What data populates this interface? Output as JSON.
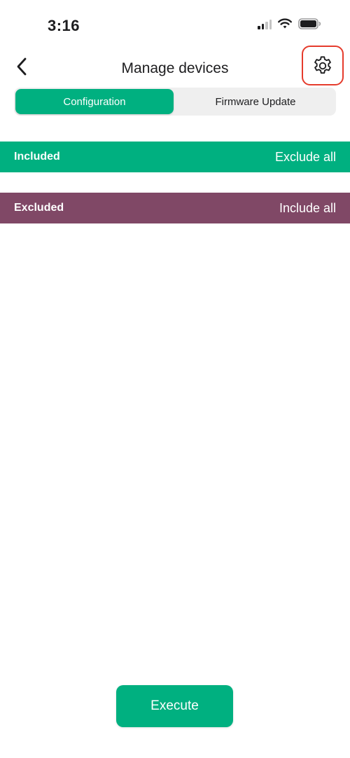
{
  "status_bar": {
    "time": "3:16",
    "icons": [
      "cellular-signal-icon",
      "wifi-icon",
      "battery-icon"
    ]
  },
  "nav": {
    "title": "Manage devices",
    "back_icon": "chevron-left-icon",
    "settings_icon": "gear-icon"
  },
  "tabs": [
    {
      "label": "Configuration",
      "selected": true
    },
    {
      "label": "Firmware Update",
      "selected": false
    }
  ],
  "sections": {
    "included": {
      "label": "Included",
      "action": "Exclude all",
      "color": "#00b080"
    },
    "excluded": {
      "label": "Excluded",
      "action": "Include all",
      "color": "#804866"
    }
  },
  "execute": {
    "label": "Execute"
  },
  "colors": {
    "accent": "#00b080",
    "excluded_bar": "#804866",
    "highlight_outline": "#e53b2c"
  }
}
